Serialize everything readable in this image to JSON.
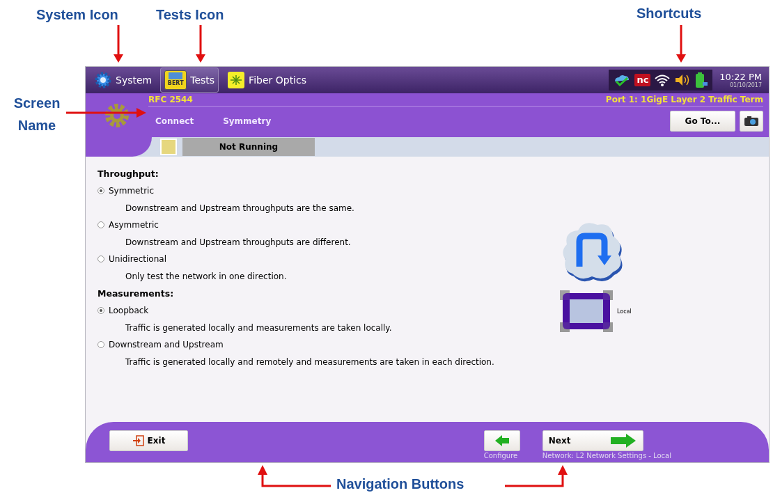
{
  "annotations": [
    {
      "kind": "down",
      "label": "System Icon"
    },
    {
      "kind": "down",
      "label": "Tests Icon"
    },
    {
      "kind": "down",
      "label": "Shortcuts"
    },
    {
      "kind": "right",
      "label": "Screen Name"
    },
    {
      "kind": "bracket",
      "label": "Navigation Buttons"
    }
  ],
  "topbar": {
    "tabs": [
      {
        "kind": "system",
        "label": "System",
        "selected": false
      },
      {
        "kind": "tests",
        "label": "Tests",
        "badge": "BERT",
        "selected": true
      },
      {
        "kind": "fiber",
        "label": "Fiber Optics",
        "selected": false
      }
    ],
    "shortcut_logo": "nc",
    "time": "10:22 PM",
    "date": "01/10/2017"
  },
  "header": {
    "test_name": "RFC 2544",
    "port": "Port 1: 1GigE Layer 2 Traffic Term",
    "path": [
      "Connect",
      "Symmetry"
    ],
    "goto_button": "Go To..."
  },
  "status": {
    "label": "Not Running"
  },
  "sections": [
    {
      "title": "Throughput:",
      "options": [
        {
          "label": "Symmetric",
          "description": "Downstream and Upstream throughputs are the same.",
          "selected": true
        },
        {
          "label": "Asymmetric",
          "description": "Downstream and Upstream throughputs are different.",
          "selected": false
        },
        {
          "label": "Unidirectional",
          "description": "Only test the network in one direction.",
          "selected": false
        }
      ]
    },
    {
      "title": "Measurements:",
      "options": [
        {
          "label": "Loopback",
          "description": "Traffic is generated locally and measurements are taken locally.",
          "selected": true
        },
        {
          "label": "Downstream and Upstream",
          "description": "Traffic is generated locally and remotely and measurements are taken in each direction.",
          "selected": false
        }
      ]
    }
  ],
  "diagram": {
    "device_label": "Local"
  },
  "footer": {
    "exit_button": "Exit",
    "back_caption": "Configure",
    "next_button": "Next",
    "next_caption": "Network: L2 Network Settings - Local"
  }
}
